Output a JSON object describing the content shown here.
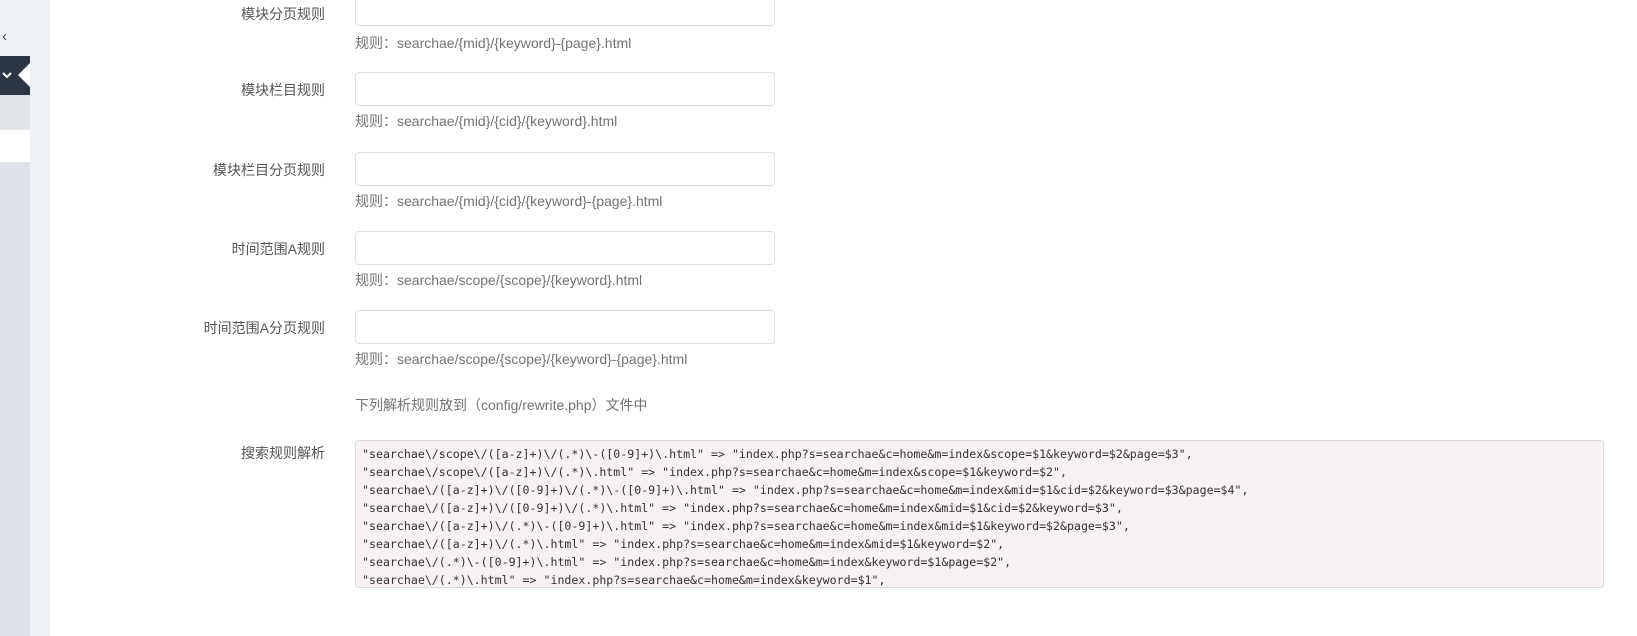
{
  "sidebar": {
    "collapse_icon": "chevron-left-icon",
    "active_icon": "chevron-down-icon"
  },
  "form": {
    "rows": [
      {
        "label": "模块分页规则",
        "value": "",
        "hint": "规则：searchae/{mid}/{keyword}-{page}.html"
      },
      {
        "label": "模块栏目规则",
        "value": "",
        "hint": "规则：searchae/{mid}/{cid}/{keyword}.html"
      },
      {
        "label": "模块栏目分页规则",
        "value": "",
        "hint": "规则：searchae/{mid}/{cid}/{keyword}-{page}.html"
      },
      {
        "label": "时间范围A规则",
        "value": "",
        "hint": "规则：searchae/scope/{scope}/{keyword}.html"
      },
      {
        "label": "时间范围A分页规则",
        "value": "",
        "hint": "规则：searchae/scope/{scope}/{keyword}-{page}.html"
      }
    ],
    "note": "下列解析规则放到（config/rewrite.php）文件中",
    "rewrite": {
      "label": "搜索规则解析",
      "lines": [
        "\"searchae\\/scope\\/([a-z]+)\\/(.*)\\-([0-9]+)\\.html\" => \"index.php?s=searchae&c=home&m=index&scope=$1&keyword=$2&page=$3\",",
        "\"searchae\\/scope\\/([a-z]+)\\/(.*)\\.html\" => \"index.php?s=searchae&c=home&m=index&scope=$1&keyword=$2\",",
        "\"searchae\\/([a-z]+)\\/([0-9]+)\\/(.*)\\-([0-9]+)\\.html\" => \"index.php?s=searchae&c=home&m=index&mid=$1&cid=$2&keyword=$3&page=$4\",",
        "\"searchae\\/([a-z]+)\\/([0-9]+)\\/(.*)\\.html\" => \"index.php?s=searchae&c=home&m=index&mid=$1&cid=$2&keyword=$3\",",
        "\"searchae\\/([a-z]+)\\/(.*)\\-([0-9]+)\\.html\" => \"index.php?s=searchae&c=home&m=index&mid=$1&keyword=$2&page=$3\",",
        "\"searchae\\/([a-z]+)\\/(.*)\\.html\" => \"index.php?s=searchae&c=home&m=index&mid=$1&keyword=$2\",",
        "\"searchae\\/(.*)\\-([0-9]+)\\.html\" => \"index.php?s=searchae&c=home&m=index&keyword=$1&page=$2\",",
        "\"searchae\\/(.*)\\.html\" => \"index.php?s=searchae&c=home&m=index&keyword=$1\","
      ]
    }
  }
}
